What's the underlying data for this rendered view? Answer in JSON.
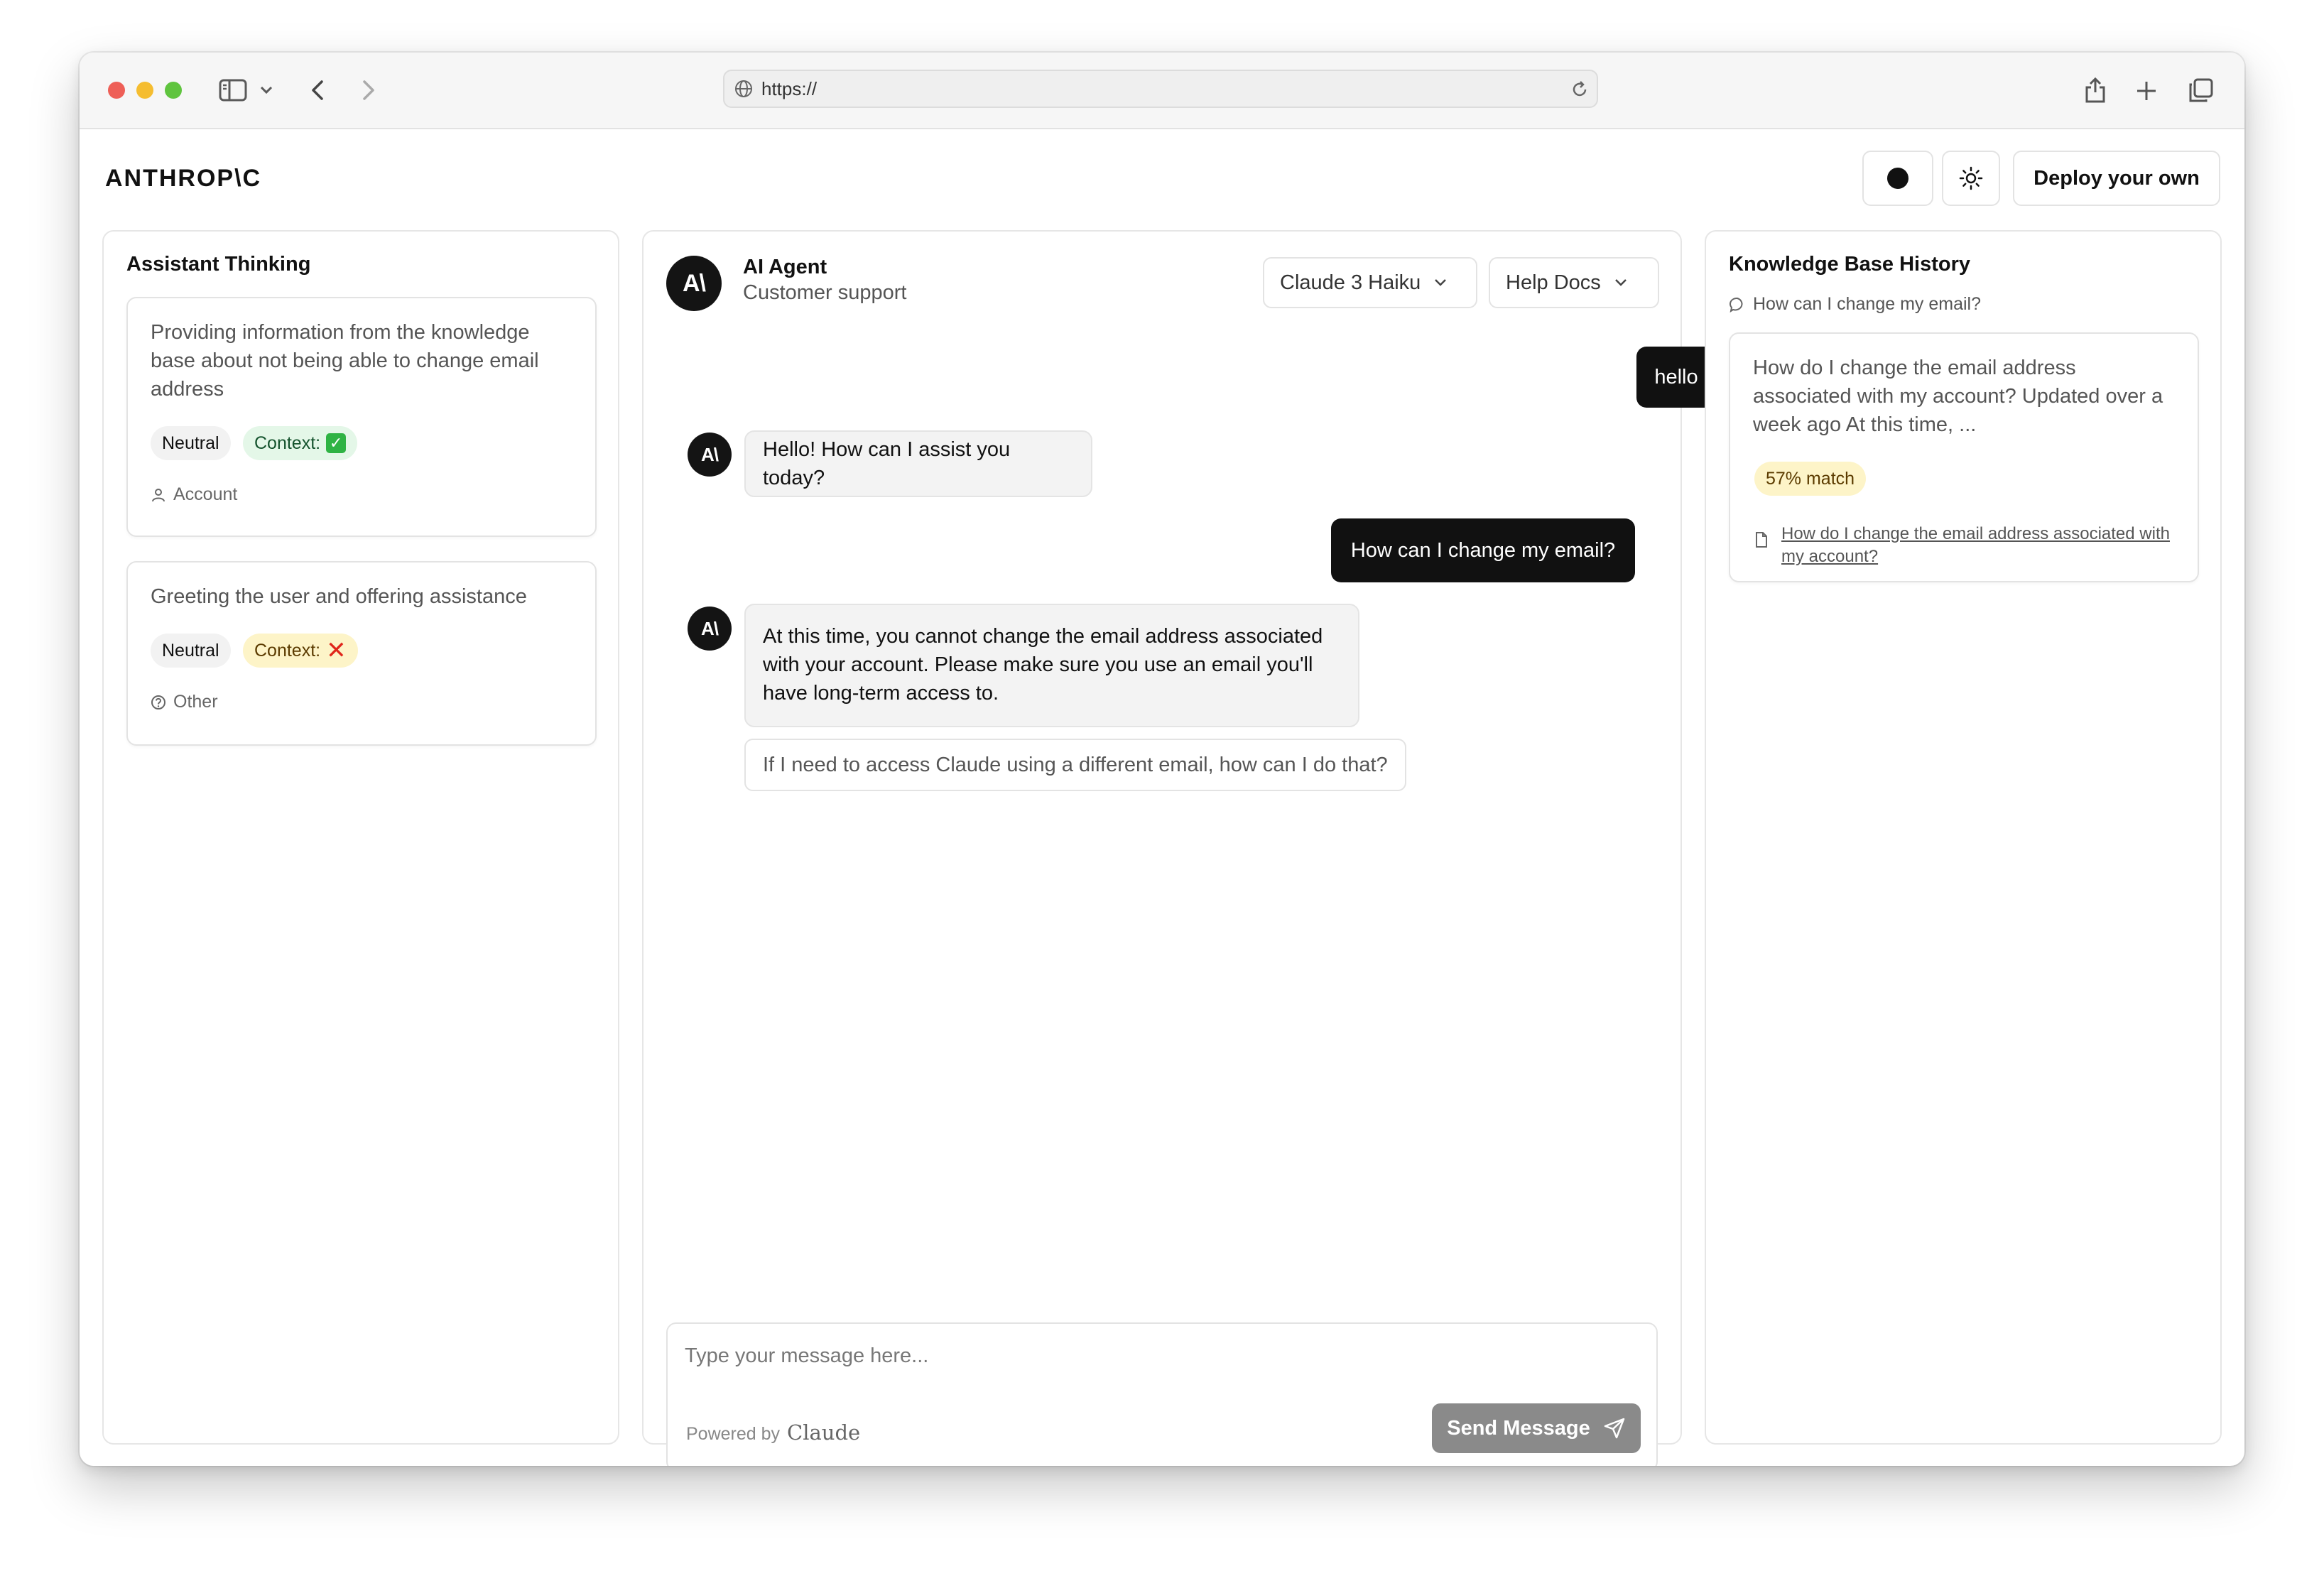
{
  "browser": {
    "url": "https://"
  },
  "header": {
    "brand": "ANTHROP\\C",
    "deploy_label": "Deploy your own"
  },
  "thinking": {
    "title": "Assistant Thinking",
    "cards": [
      {
        "text": "Providing information from the knowledge base about not being able to change email address",
        "sentiment": "Neutral",
        "context_label": "Context:",
        "context_ok": true,
        "category": "Account",
        "category_icon": "user-icon"
      },
      {
        "text": "Greeting the user and offering assistance",
        "sentiment": "Neutral",
        "context_label": "Context:",
        "context_ok": false,
        "category": "Other",
        "category_icon": "help-circle-icon"
      }
    ]
  },
  "chat": {
    "agent_name": "AI Agent",
    "agent_role": "Customer support",
    "avatar_text": "A\\",
    "model_select": "Claude 3 Haiku",
    "kb_select": "Help Docs",
    "messages": [
      {
        "role": "user",
        "text": "hello"
      },
      {
        "role": "assistant",
        "text": "Hello! How can I assist you today?"
      },
      {
        "role": "user",
        "text": "How can I change my email?"
      },
      {
        "role": "assistant",
        "lines": [
          "At this time, you cannot change the email address associated",
          "with your account. Please make sure you use an email you'll",
          "have long-term access to."
        ]
      }
    ],
    "suggestion": "If I need to access Claude using a different email, how can I do that?",
    "input_placeholder": "Type your message here...",
    "powered_by": "Powered by",
    "powered_brand": "Claude",
    "send_label": "Send Message"
  },
  "kb": {
    "title": "Knowledge Base History",
    "query": "How can I change my email?",
    "result_text": "How do I change the email address associated with my account? Updated over a week ago At this time, ...",
    "match": "57% match",
    "link_text": "How do I change the email address associated with my account?"
  },
  "colors": {
    "accent_dark": "#111111",
    "context_ok_bg": "#e4f7e8",
    "context_bad_bg": "#fdf4c8",
    "send_disabled": "#8a8a8a"
  }
}
